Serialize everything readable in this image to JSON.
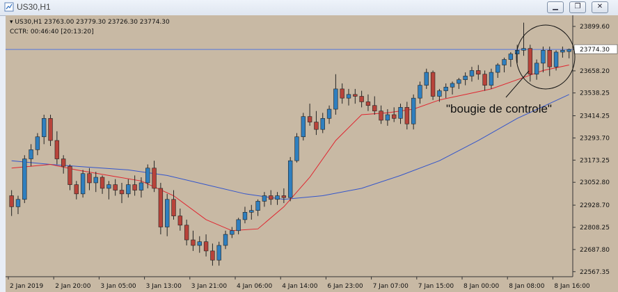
{
  "window": {
    "title": "US30,H1",
    "buttons": [
      "minimize",
      "restore",
      "close"
    ]
  },
  "info": {
    "header": "US30,H1  23763.00 23779.30 23726.30 23774.30",
    "indicator": "CCTR: 00:46:40 [20:13:20]"
  },
  "annotation": "\"bougie de controle\"",
  "colors": {
    "background": "#c8b9a4",
    "bull": "#2f7fbf",
    "bear": "#b8433a",
    "ma_fast": "#e0252f",
    "ma_slow": "#3355cc",
    "price_line": "#5577dd"
  },
  "chart_data": {
    "type": "candlestick",
    "symbol": "US30",
    "timeframe": "H1",
    "current_price": "23774.30",
    "y_ticks": [
      "23899.60",
      "23774.30",
      "23658.20",
      "23538.25",
      "23414.25",
      "23293.70",
      "23173.25",
      "23052.80",
      "22928.70",
      "22808.25",
      "22687.80",
      "22567.35"
    ],
    "x_labels": [
      "2 Jan 2019",
      "2 Jan 20:00",
      "3 Jan 05:00",
      "3 Jan 13:00",
      "3 Jan 21:00",
      "4 Jan 06:00",
      "4 Jan 14:00",
      "6 Jan 23:00",
      "7 Jan 07:00",
      "7 Jan 15:00",
      "8 Jan 00:00",
      "8 Jan 08:00",
      "8 Jan 16:00"
    ],
    "ylim": [
      22540,
      23960
    ],
    "candles": [
      [
        22980,
        23010,
        22870,
        22920
      ],
      [
        22920,
        22980,
        22880,
        22960
      ],
      [
        22960,
        23200,
        22940,
        23180
      ],
      [
        23180,
        23260,
        23140,
        23230
      ],
      [
        23230,
        23320,
        23200,
        23300
      ],
      [
        23300,
        23420,
        23260,
        23400
      ],
      [
        23400,
        23420,
        23250,
        23280
      ],
      [
        23280,
        23330,
        23150,
        23180
      ],
      [
        23180,
        23200,
        23100,
        23140
      ],
      [
        23140,
        23150,
        23010,
        23040
      ],
      [
        23040,
        23060,
        22960,
        22990
      ],
      [
        22990,
        23120,
        22970,
        23100
      ],
      [
        23100,
        23130,
        23010,
        23050
      ],
      [
        23050,
        23110,
        23000,
        23080
      ],
      [
        23080,
        23090,
        22990,
        23020
      ],
      [
        23020,
        23060,
        22960,
        23040
      ],
      [
        23040,
        23070,
        22980,
        23010
      ],
      [
        23010,
        23050,
        22940,
        22990
      ],
      [
        22990,
        23070,
        22970,
        23040
      ],
      [
        23040,
        23090,
        22980,
        23010
      ],
      [
        23010,
        23080,
        22970,
        23050
      ],
      [
        23050,
        23150,
        23020,
        23130
      ],
      [
        23130,
        23170,
        23000,
        23020
      ],
      [
        23020,
        23050,
        22770,
        22810
      ],
      [
        22810,
        22990,
        22760,
        22960
      ],
      [
        22960,
        23010,
        22850,
        22870
      ],
      [
        22870,
        22910,
        22790,
        22820
      ],
      [
        22820,
        22850,
        22710,
        22740
      ],
      [
        22740,
        22790,
        22680,
        22710
      ],
      [
        22710,
        22760,
        22670,
        22730
      ],
      [
        22730,
        22770,
        22650,
        22680
      ],
      [
        22680,
        22720,
        22600,
        22630
      ],
      [
        22630,
        22730,
        22600,
        22710
      ],
      [
        22710,
        22790,
        22690,
        22770
      ],
      [
        22770,
        22810,
        22750,
        22790
      ],
      [
        22790,
        22860,
        22770,
        22850
      ],
      [
        22850,
        22920,
        22830,
        22890
      ],
      [
        22890,
        22930,
        22850,
        22900
      ],
      [
        22900,
        22960,
        22870,
        22950
      ],
      [
        22950,
        23000,
        22920,
        22980
      ],
      [
        22980,
        23010,
        22930,
        22960
      ],
      [
        22960,
        23000,
        22930,
        22980
      ],
      [
        22980,
        23020,
        22940,
        22970
      ],
      [
        22970,
        23190,
        22950,
        23170
      ],
      [
        23170,
        23320,
        23160,
        23300
      ],
      [
        23300,
        23430,
        23280,
        23410
      ],
      [
        23410,
        23480,
        23360,
        23380
      ],
      [
        23380,
        23440,
        23310,
        23340
      ],
      [
        23340,
        23430,
        23320,
        23400
      ],
      [
        23400,
        23470,
        23370,
        23450
      ],
      [
        23450,
        23640,
        23420,
        23560
      ],
      [
        23560,
        23590,
        23480,
        23510
      ],
      [
        23510,
        23560,
        23470,
        23530
      ],
      [
        23530,
        23560,
        23480,
        23520
      ],
      [
        23520,
        23550,
        23460,
        23490
      ],
      [
        23490,
        23530,
        23440,
        23470
      ],
      [
        23470,
        23520,
        23420,
        23440
      ],
      [
        23440,
        23470,
        23370,
        23390
      ],
      [
        23390,
        23450,
        23360,
        23420
      ],
      [
        23420,
        23460,
        23380,
        23400
      ],
      [
        23400,
        23480,
        23370,
        23460
      ],
      [
        23460,
        23490,
        23340,
        23370
      ],
      [
        23370,
        23530,
        23340,
        23510
      ],
      [
        23510,
        23600,
        23480,
        23580
      ],
      [
        23580,
        23670,
        23560,
        23650
      ],
      [
        23650,
        23660,
        23500,
        23520
      ],
      [
        23520,
        23560,
        23490,
        23550
      ],
      [
        23550,
        23590,
        23510,
        23570
      ],
      [
        23570,
        23600,
        23530,
        23590
      ],
      [
        23590,
        23620,
        23560,
        23610
      ],
      [
        23610,
        23650,
        23580,
        23630
      ],
      [
        23630,
        23680,
        23600,
        23660
      ],
      [
        23660,
        23690,
        23610,
        23640
      ],
      [
        23640,
        23660,
        23550,
        23580
      ],
      [
        23580,
        23670,
        23560,
        23650
      ],
      [
        23650,
        23700,
        23620,
        23690
      ],
      [
        23690,
        23730,
        23650,
        23720
      ],
      [
        23720,
        23760,
        23680,
        23750
      ],
      [
        23750,
        23800,
        23700,
        23770
      ],
      [
        23770,
        23920,
        23740,
        23780
      ],
      [
        23780,
        23800,
        23600,
        23640
      ],
      [
        23640,
        23720,
        23610,
        23700
      ],
      [
        23700,
        23790,
        23650,
        23770
      ],
      [
        23770,
        23790,
        23630,
        23680
      ],
      [
        23680,
        23770,
        23660,
        23760
      ],
      [
        23760,
        23790,
        23730,
        23770
      ],
      [
        23763,
        23779.3,
        23726.3,
        23774.3
      ]
    ],
    "ma_fast": [
      [
        0,
        23130
      ],
      [
        6,
        23150
      ],
      [
        10,
        23120
      ],
      [
        15,
        23090
      ],
      [
        20,
        23060
      ],
      [
        25,
        22980
      ],
      [
        30,
        22850
      ],
      [
        34,
        22790
      ],
      [
        38,
        22800
      ],
      [
        42,
        22920
      ],
      [
        46,
        23080
      ],
      [
        50,
        23280
      ],
      [
        54,
        23420
      ],
      [
        58,
        23430
      ],
      [
        62,
        23450
      ],
      [
        66,
        23500
      ],
      [
        70,
        23530
      ],
      [
        74,
        23560
      ],
      [
        78,
        23610
      ],
      [
        82,
        23660
      ],
      [
        86,
        23690
      ]
    ],
    "ma_slow": [
      [
        0,
        23170
      ],
      [
        6,
        23150
      ],
      [
        12,
        23135
      ],
      [
        18,
        23120
      ],
      [
        24,
        23090
      ],
      [
        30,
        23040
      ],
      [
        36,
        22990
      ],
      [
        42,
        22960
      ],
      [
        48,
        22980
      ],
      [
        54,
        23020
      ],
      [
        60,
        23090
      ],
      [
        66,
        23170
      ],
      [
        72,
        23280
      ],
      [
        78,
        23400
      ],
      [
        86,
        23530
      ]
    ]
  }
}
